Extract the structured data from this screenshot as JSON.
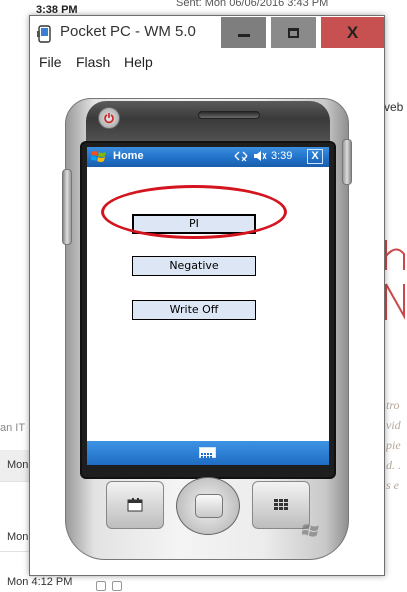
{
  "background": {
    "top_time": "3:38 PM",
    "sent_header": "Sent:    Mon 06/06/2016 3:43 PM",
    "row_labels": [
      "Mon",
      "Mon"
    ],
    "fragment_it": "an IT",
    "bottom_time": "Mon 4:12 PM",
    "right_word": "veb",
    "italic_lines": [
      "tro",
      "vid",
      "pie",
      "d. .",
      "s e"
    ]
  },
  "window": {
    "title": "Pocket PC - WM 5.0",
    "close_glyph": "X",
    "menu": [
      "File",
      "Flash",
      "Help"
    ]
  },
  "device_screen": {
    "taskbar_title": "Home",
    "time": "3:39",
    "close_label": "X",
    "buttons": [
      "PI",
      "Negative",
      "Write Off"
    ]
  },
  "colors": {
    "highlight": "#d4141f",
    "taskbar": "#1f6fc6",
    "button_face": "#dce6f4"
  }
}
